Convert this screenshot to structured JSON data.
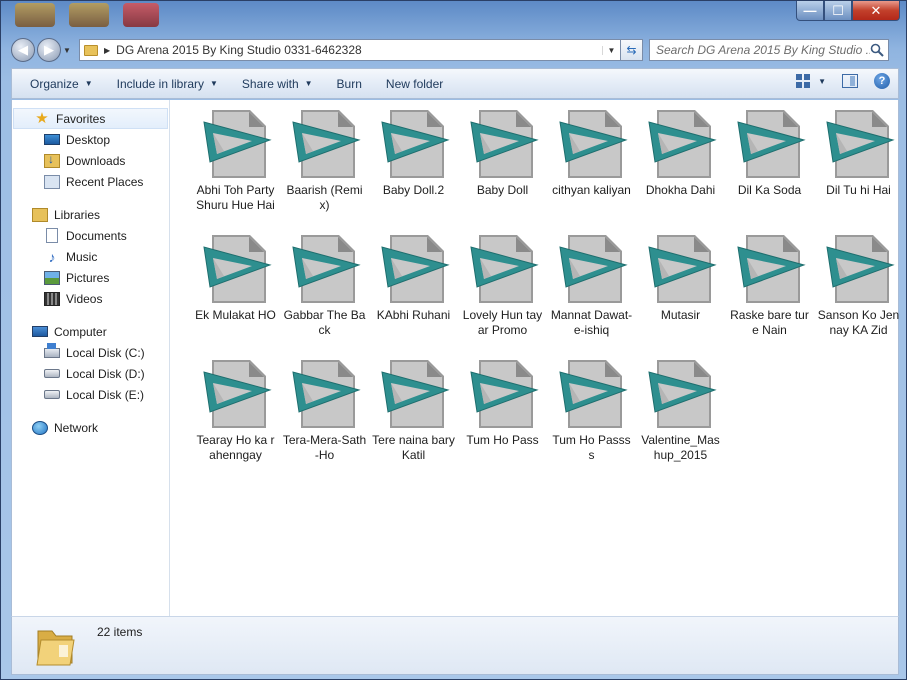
{
  "window": {
    "minimize_glyph": "—",
    "maximize_glyph": "☐",
    "close_glyph": "✕"
  },
  "address": {
    "path": "DG Arena 2015 By King Studio 0331-6462328"
  },
  "search": {
    "placeholder": "Search DG Arena 2015 By King Studio ..."
  },
  "toolbar": {
    "organize": "Organize",
    "include_in_library": "Include in library",
    "share_with": "Share with",
    "burn": "Burn",
    "new_folder": "New folder"
  },
  "nav": {
    "favorites": {
      "label": "Favorites",
      "items": [
        "Desktop",
        "Downloads",
        "Recent Places"
      ]
    },
    "libraries": {
      "label": "Libraries",
      "items": [
        "Documents",
        "Music",
        "Pictures",
        "Videos"
      ]
    },
    "computer": {
      "label": "Computer",
      "items": [
        "Local Disk (C:)",
        "Local Disk (D:)",
        "Local Disk (E:)"
      ]
    },
    "network": {
      "label": "Network"
    }
  },
  "files": [
    "Abhi Toh Party Shuru Hue Hai",
    "Baarish (Remix)",
    "Baby Doll.2",
    "Baby Doll",
    "cithyan kaliyan",
    "Dhokha Dahi",
    "Dil Ka Soda",
    "Dil Tu hi Hai",
    "Ek Mulakat HO",
    "Gabbar The Back",
    "KAbhi Ruhani",
    "Lovely Hun tayar Promo",
    "Mannat Dawat-e-ishiq",
    "Mutasir",
    "Raske bare ture Nain",
    "Sanson Ko Jennay KA Zid",
    "Tearay Ho ka rahenngay",
    "Tera-Mera-Sath-Ho",
    "Tere naina bary Katil",
    "Tum Ho Pass",
    "Tum Ho Passss",
    "Valentine_Mashup_2015"
  ],
  "file_icon": "media-play-file-icon",
  "status": {
    "item_count": "22 items"
  },
  "colors": {
    "play_teal": "#2e8f8f",
    "toolbar_text": "#1e395b"
  }
}
